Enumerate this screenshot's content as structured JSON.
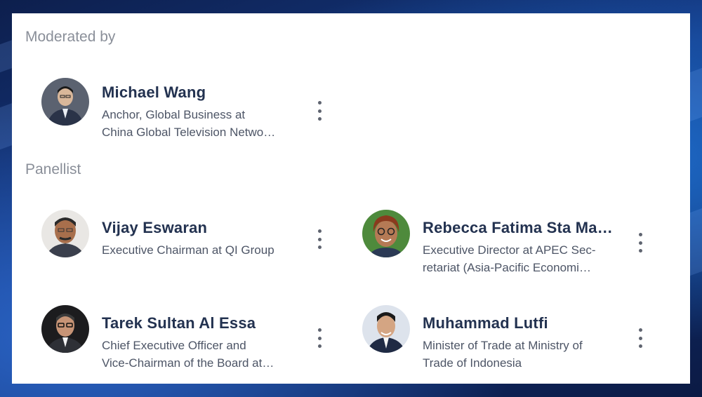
{
  "moderated_section": {
    "title": "Moderated by",
    "person": {
      "name": "Michael Wang",
      "role_line1": "Anchor, Global Business at",
      "role_line2": "China Global Television Netwo…",
      "avatar_icon": "person-avatar-suit"
    }
  },
  "panellist_section": {
    "title": "Panellist",
    "people": [
      {
        "name": "Vijay Eswaran",
        "role_line1": "Executive Chairman at QI Group",
        "role_line2": "",
        "avatar_icon": "person-avatar-suit"
      },
      {
        "name": "Rebecca Fatima Sta Ma…",
        "role_line1": "Executive Director at APEC Sec-",
        "role_line2": "retariat (Asia-Pacific Economi…",
        "avatar_icon": "person-avatar-glasses"
      },
      {
        "name": "Tarek Sultan Al Essa",
        "role_line1": "Chief Executive Officer and",
        "role_line2": "Vice-Chairman of the Board at…",
        "avatar_icon": "person-avatar-glasses"
      },
      {
        "name": "Muhammad Lutfi",
        "role_line1": "Minister of Trade at Ministry of",
        "role_line2": "Trade of Indonesia",
        "avatar_icon": "person-avatar-suit"
      }
    ]
  },
  "colors": {
    "name_text": "#233250",
    "role_text": "#4d5566",
    "section_title": "#8a8f99",
    "background_blue": "#153a86"
  }
}
